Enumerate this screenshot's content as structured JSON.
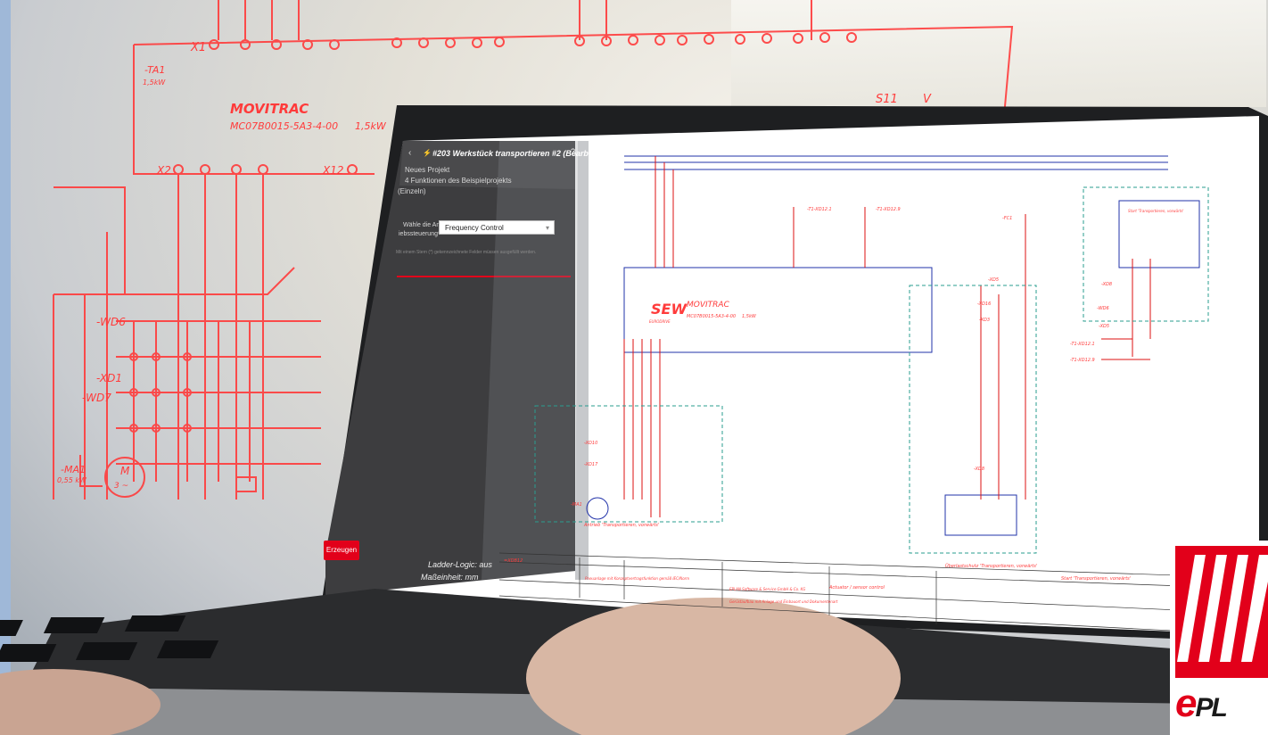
{
  "hologram": {
    "ta1": "-TA1",
    "ta1_kw": "1,5kW",
    "x1": "X1",
    "movitrac": "MOVITRAC",
    "model": "MC07B0015-5A3-4-00",
    "model_kw": "1,5kW",
    "x2": "X2",
    "x12": "X12",
    "s11": "S11",
    "s11_v": "V",
    "wd6": "-WD6",
    "xd1": "-XD1",
    "wd7": "-WD7",
    "ma1": "-MA1",
    "ma1_kw": "0,55 kW",
    "motor": "M",
    "motor_phase": "3 ~"
  },
  "app": {
    "back_icon": "chevron-left-icon",
    "bolt_icon": "lightning-icon",
    "title": "#203 Werkstück transportieren #2 (Bearbeiten)",
    "help_icon": "help-icon",
    "breadcrumb_1": "Neues Projekt",
    "breadcrumb_2": "4 Funktionen des Beispielprojekts",
    "breadcrumb_3": "(Einzeln)",
    "field_label_1": "Wähle die Antr",
    "field_label_2": "iebssteuerung*",
    "field_value": "Frequency Control",
    "required_hint": "Mit einem Stern (*) gekennzeichnete Felder müssen ausgefüllt werden.",
    "generate_button": "Erzeugen",
    "footer_line_1": "Ladder-Logic: aus",
    "footer_line_2": "Maßeinheit: mm"
  },
  "schematic": {
    "brand": "SEW",
    "brand_sub": "EURODRIVE",
    "device": "MOVITRAC",
    "device_model": "MC07B0015-5A3-4-00",
    "device_kw": "1,5kW",
    "ref_1": "-T1-XD12.1",
    "ref_2": "-T1-XD12.9",
    "ref_3": "-T1-XD12.1",
    "ref_4": "-T1-XD12.9",
    "fc1": "-FC1",
    "xd5": "-XD5",
    "xd16": "-XD16",
    "xd3": "-XD3",
    "xd8": "-XD8",
    "wd6": "-WD6",
    "xd5b": "-XD5",
    "xd8b": "-XD8",
    "box_label": "Start 'Transportieren, vorwärts'",
    "overshoot": "Überlastschutz 'Transportieren, vorwärts'",
    "start_note": "Start 'Transportieren, vorwärts'",
    "motor_note": "Antrieb 'Transportieren, vorwärts'",
    "ma1": "-MA1",
    "actuator_note": "Actuator / sensor control",
    "company": "EPLAN Software & Service GmbH & Co. KG",
    "company_desc": "Gerüstaufbau mit Anlage und Einbauort und Dokumentenart",
    "plant_desc": "Pneuanlage mit Konzeptvertragsfunktion gemäß IEC/Norm",
    "sheet_ref": "+A1",
    "xd_label": "=XDB12",
    "xd17": "-XD17",
    "xd10": "-XD10"
  },
  "logo": {
    "e_letter": "e",
    "pl": "PL"
  },
  "colors": {
    "accent_red": "#e2001a",
    "holo_red": "#ff3b3b",
    "ui_dark": "#3d3d3f",
    "schematic_blue": "#2233aa",
    "schematic_teal": "#2a9d8f"
  }
}
